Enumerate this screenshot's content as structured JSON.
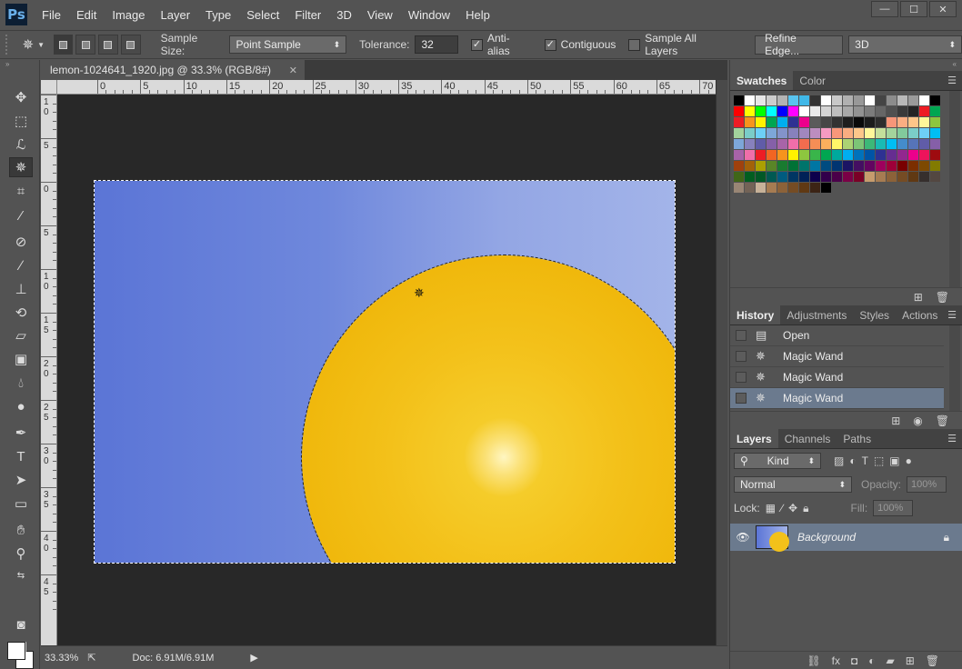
{
  "app": {
    "logo": "Ps"
  },
  "menu": [
    "File",
    "Edit",
    "Image",
    "Layer",
    "Type",
    "Select",
    "Filter",
    "3D",
    "View",
    "Window",
    "Help"
  ],
  "window_controls": {
    "minimize": "—",
    "maximize": "☐",
    "close": "✕"
  },
  "options": {
    "sample_size_label": "Sample Size:",
    "sample_size_value": "Point Sample",
    "tolerance_label": "Tolerance:",
    "tolerance_value": "32",
    "anti_alias": "Anti-alias",
    "contiguous": "Contiguous",
    "sample_all_layers": "Sample All Layers",
    "refine_edge": "Refine Edge...",
    "workspace": "3D"
  },
  "document": {
    "tab_title": "lemon-1024641_1920.jpg @ 33.3% (RGB/8#)",
    "ruler_h": [
      "0",
      "5",
      "10",
      "15",
      "20",
      "25",
      "30",
      "35",
      "40",
      "45",
      "50",
      "55",
      "60",
      "65",
      "70"
    ],
    "ruler_v": [
      "10",
      "5",
      "0",
      "5",
      "10",
      "15",
      "20",
      "25",
      "30",
      "35",
      "40",
      "45"
    ],
    "zoom": "33.33%",
    "doc_size": "Doc: 6.91M/6.91M"
  },
  "panels": {
    "swatches": {
      "tabs": [
        "Swatches",
        "Color"
      ],
      "colors": [
        "#000000",
        "#ffffff",
        "#e6e6e6",
        "#cccccc",
        "#b3b3b3",
        "#59c4ef",
        "#40b8e8",
        "#333333",
        "#ffffff",
        "#c8c8c8",
        "#b0b0b0",
        "#989898",
        "#ffffff",
        "#444444",
        "#8c8c8c",
        "#b8b8b8",
        "#9a9a9a",
        "#ffffff",
        "#000000",
        "#ff0000",
        "#ffff00",
        "#00ff00",
        "#00ffff",
        "#0000ff",
        "#ff00ff",
        "#ffffff",
        "#eaeaea",
        "#d4d4d4",
        "#bebebe",
        "#a8a8a8",
        "#929292",
        "#7c7c7c",
        "#666666",
        "#505050",
        "#3a3a3a",
        "#242424",
        "#ed1c24",
        "#00a651",
        "#ed1c24",
        "#f7941d",
        "#fff200",
        "#00a651",
        "#00aeef",
        "#2e3192",
        "#ec008c",
        "#5a5a5a",
        "#464646",
        "#323232",
        "#1e1e1e",
        "#0a0a0a",
        "#1c1c1c",
        "#2d2d2d",
        "#f79679",
        "#fbae82",
        "#fdc689",
        "#fff799",
        "#8dc63f",
        "#a3d39c",
        "#7accc8",
        "#6dcff6",
        "#7da7d9",
        "#8393ca",
        "#8781bd",
        "#a187be",
        "#bc8dbf",
        "#f49ac2",
        "#f7977a",
        "#f9ad81",
        "#fdc68a",
        "#fff79a",
        "#c4df9b",
        "#a3d39c",
        "#82ca9c",
        "#7bcdc8",
        "#6ecff6",
        "#00bff3",
        "#7da7d9",
        "#8781bd",
        "#605ca8",
        "#8560a8",
        "#a864a8",
        "#f06eaa",
        "#f26c4f",
        "#f68e56",
        "#fbaf5d",
        "#fff568",
        "#acd373",
        "#7cc576",
        "#3cb878",
        "#1abbb4",
        "#00bff3",
        "#448ccb",
        "#5674b9",
        "#605ca8",
        "#855fa8",
        "#a763a8",
        "#f06ea9",
        "#ed1c24",
        "#f26522",
        "#f7941d",
        "#fff200",
        "#8dc63f",
        "#39b54a",
        "#00a651",
        "#00a99d",
        "#00aeef",
        "#0072bc",
        "#0054a6",
        "#2e3192",
        "#662d91",
        "#92278f",
        "#ec008c",
        "#ed145b",
        "#9e0b0f",
        "#a0410d",
        "#a36209",
        "#aba000",
        "#598527",
        "#197b30",
        "#007236",
        "#00746b",
        "#0076a3",
        "#004b80",
        "#003471",
        "#1b1464",
        "#440e62",
        "#630460",
        "#9e005d",
        "#9e0039",
        "#790000",
        "#7b2e00",
        "#7d4900",
        "#827b00",
        "#406618",
        "#005e20",
        "#005826",
        "#005952",
        "#005b7f",
        "#003663",
        "#002157",
        "#0d004c",
        "#32004b",
        "#4b0049",
        "#7b0046",
        "#7a0026",
        "#c69c6d",
        "#a67c52",
        "#8c6239",
        "#754c24",
        "#603913",
        "#362f2d",
        "#534741",
        "#998675",
        "#736357",
        "#c7b299",
        "#a67c52",
        "#8c6239",
        "#754c24",
        "#603913",
        "#3c2415",
        "#000000"
      ]
    },
    "history": {
      "tabs": [
        "History",
        "Adjustments",
        "Styles",
        "Actions"
      ],
      "items": [
        "Open",
        "Magic Wand",
        "Magic Wand",
        "Magic Wand"
      ]
    },
    "layers": {
      "tabs": [
        "Layers",
        "Channels",
        "Paths"
      ],
      "kind": "Kind",
      "blend_mode": "Normal",
      "opacity_label": "Opacity:",
      "opacity_value": "100%",
      "lock_label": "Lock:",
      "fill_label": "Fill:",
      "fill_value": "100%",
      "layer_name": "Background"
    }
  }
}
